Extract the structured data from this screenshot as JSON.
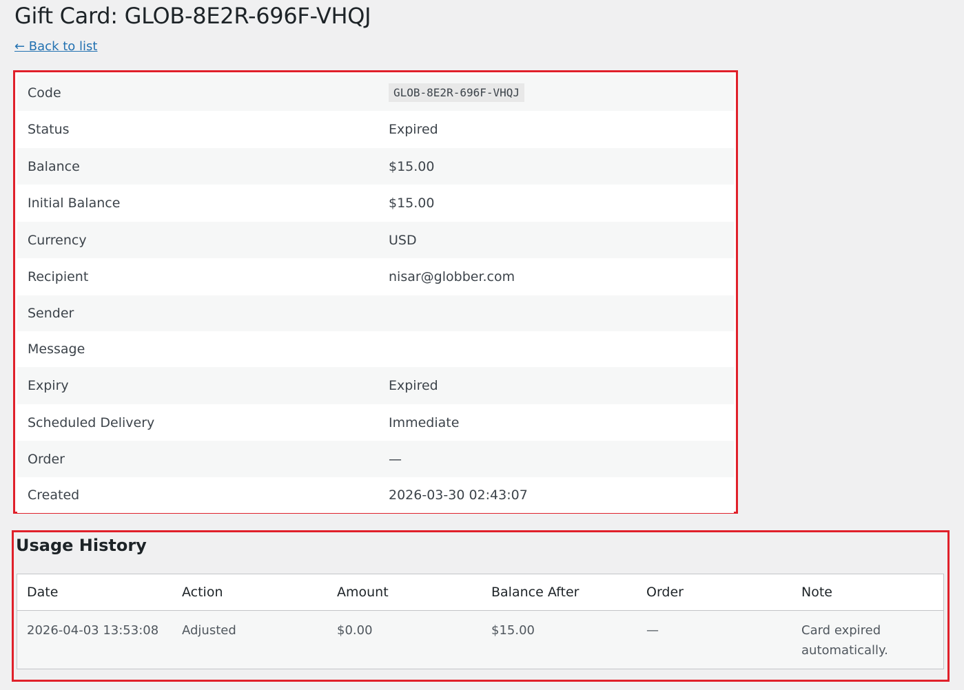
{
  "page": {
    "title": "Gift Card: GLOB-8E2R-696F-VHQJ",
    "back_link": "← Back to list"
  },
  "details": {
    "rows": [
      {
        "label": "Code",
        "value": "GLOB-8E2R-696F-VHQJ"
      },
      {
        "label": "Status",
        "value": "Expired"
      },
      {
        "label": "Balance",
        "value": "$15.00"
      },
      {
        "label": "Initial Balance",
        "value": "$15.00"
      },
      {
        "label": "Currency",
        "value": "USD"
      },
      {
        "label": "Recipient",
        "value": "nisar@globber.com"
      },
      {
        "label": "Sender",
        "value": ""
      },
      {
        "label": "Message",
        "value": ""
      },
      {
        "label": "Expiry",
        "value": "Expired"
      },
      {
        "label": "Scheduled Delivery",
        "value": "Immediate"
      },
      {
        "label": "Order",
        "value": "—"
      },
      {
        "label": "Created",
        "value": "2026-03-30 02:43:07"
      }
    ]
  },
  "usage": {
    "title": "Usage History",
    "columns": [
      "Date",
      "Action",
      "Amount",
      "Balance After",
      "Order",
      "Note"
    ],
    "rows": [
      {
        "date": "2026-04-03 13:53:08",
        "action": "Adjusted",
        "amount": "$0.00",
        "balance_after": "$15.00",
        "order": "—",
        "note": "Card expired automatically."
      }
    ]
  },
  "colors": {
    "background": "#f0f0f1",
    "link": "#2271b1",
    "highlight_border": "#e0202a",
    "row_alt": "#f6f7f7"
  }
}
